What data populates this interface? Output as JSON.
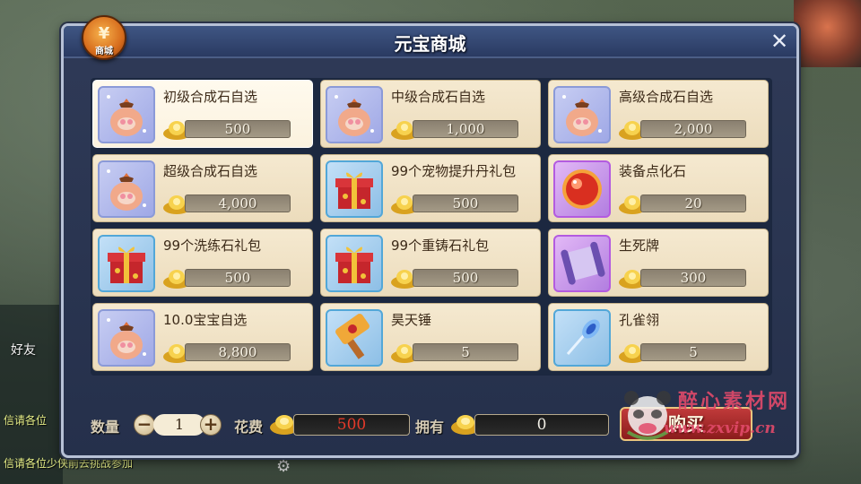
{
  "window": {
    "title": "元宝商城",
    "close_label": "✕",
    "badge_label": "商城",
    "badge_glyph": "¥"
  },
  "items": [
    {
      "name": "初级合成石自选",
      "price": "500",
      "icon": "pouch-icon",
      "frame": "lilac"
    },
    {
      "name": "中级合成石自选",
      "price": "1,000",
      "icon": "pouch-icon",
      "frame": "lilac"
    },
    {
      "name": "高级合成石自选",
      "price": "2,000",
      "icon": "pouch-icon",
      "frame": "lilac"
    },
    {
      "name": "超级合成石自选",
      "price": "4,000",
      "icon": "pouch-icon",
      "frame": "lilac"
    },
    {
      "name": "99个宠物提升丹礼包",
      "price": "500",
      "icon": "gift-box-icon",
      "frame": "blue"
    },
    {
      "name": "装备点化石",
      "price": "20",
      "icon": "red-orb-icon",
      "frame": "purple"
    },
    {
      "name": "99个洗练石礼包",
      "price": "500",
      "icon": "gift-box-icon",
      "frame": "blue"
    },
    {
      "name": "99个重铸石礼包",
      "price": "500",
      "icon": "gift-box-icon",
      "frame": "blue"
    },
    {
      "name": "生死牌",
      "price": "300",
      "icon": "scroll-icon",
      "frame": "purple"
    },
    {
      "name": "10.0宝宝自选",
      "price": "8,800",
      "icon": "pouch-icon",
      "frame": "lilac"
    },
    {
      "name": "昊天锤",
      "price": "5",
      "icon": "hammer-icon",
      "frame": "blue"
    },
    {
      "name": "孔雀翎",
      "price": "5",
      "icon": "feather-dart-icon",
      "frame": "blue"
    }
  ],
  "bottom": {
    "quantity_label": "数量",
    "quantity_value": "1",
    "minus_label": "−",
    "plus_label": "+",
    "cost_label": "花费",
    "cost_value": "500",
    "owned_label": "拥有",
    "owned_value": "0",
    "buy_label": "购买"
  },
  "background": {
    "friend_label": "好友",
    "chat_line_1": "信请各位",
    "chat_line_2": "信请各位少侠前去挑战参加"
  },
  "watermark": {
    "cn": "醉心素材网",
    "url": "www.zxvip.cn"
  },
  "colors": {
    "window_bg": "#25304b",
    "card_bg": "#f5e9d0",
    "cost_text": "#e53a2a",
    "owned_text": "#f1efe6",
    "buy_button": "#a82a2a",
    "gold_ingot": "#f2c23a"
  }
}
